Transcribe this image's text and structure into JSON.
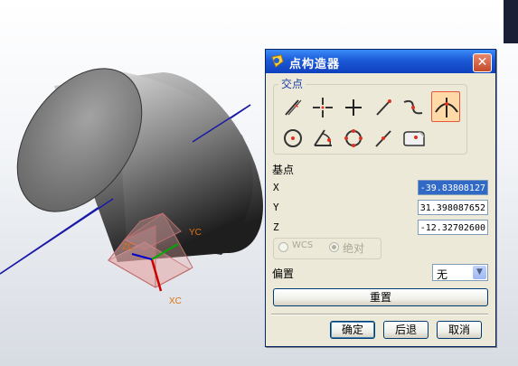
{
  "dialog": {
    "title": "点构造器",
    "close_symbol": "✕"
  },
  "intersection_group": {
    "label": "交点",
    "tools": [
      {
        "name": "inferred-point",
        "selected": false
      },
      {
        "name": "cursor-location",
        "selected": false
      },
      {
        "name": "existing-point",
        "selected": false
      },
      {
        "name": "end-point",
        "selected": false
      },
      {
        "name": "control-point",
        "selected": false
      },
      {
        "name": "intersection-point",
        "selected": true
      },
      {
        "name": "arc-center",
        "selected": false
      },
      {
        "name": "angle-on-arc",
        "selected": false
      },
      {
        "name": "quadrant-point",
        "selected": false
      },
      {
        "name": "point-on-curve",
        "selected": false
      },
      {
        "name": "point-on-surface",
        "selected": false
      }
    ]
  },
  "base_point": {
    "label": "基点",
    "x_label": "X",
    "x_value": "-39.83808127",
    "y_label": "Y",
    "y_value": "31.398087652",
    "z_label": "Z",
    "z_value": "-12.32702600",
    "wcs_label": "WCS",
    "absolute_label": "绝对"
  },
  "offset": {
    "label": "偏置",
    "value": "无"
  },
  "buttons": {
    "reset": "重置",
    "ok": "确定",
    "back": "后退",
    "cancel": "取消"
  },
  "viewport": {
    "axis_labels": {
      "xc": "XC",
      "yc": "YC",
      "zc": "ZC"
    },
    "colors": {
      "axis_line": "#1a1aa8",
      "x_axis": "#cc0000",
      "y_axis": "#00aa00",
      "z_axis": "#0000cc",
      "label": "#e07010"
    }
  }
}
